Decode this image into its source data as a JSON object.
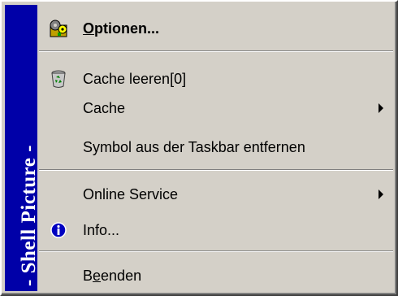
{
  "sidebar": {
    "title": "- Shell Picture -",
    "color": "#0000a8"
  },
  "menu": {
    "items": [
      {
        "label_pre": "",
        "label_ul": "O",
        "label_post": "ptionen...",
        "icon": "settings-icon",
        "bold": true
      },
      {
        "label": "Cache leeren[0]",
        "icon": "recycle-bin-icon"
      },
      {
        "label": "Cache",
        "submenu": true
      },
      {
        "label": "Symbol aus der Taskbar entfernen"
      },
      {
        "label": "Online Service",
        "submenu": true
      },
      {
        "label": "Info...",
        "icon": "info-icon"
      },
      {
        "label_pre": "B",
        "label_ul": "e",
        "label_post": "enden"
      }
    ]
  },
  "colors": {
    "menu_background": "#d4d0c8",
    "text": "#000000",
    "accent_blue": "#0000a8"
  }
}
